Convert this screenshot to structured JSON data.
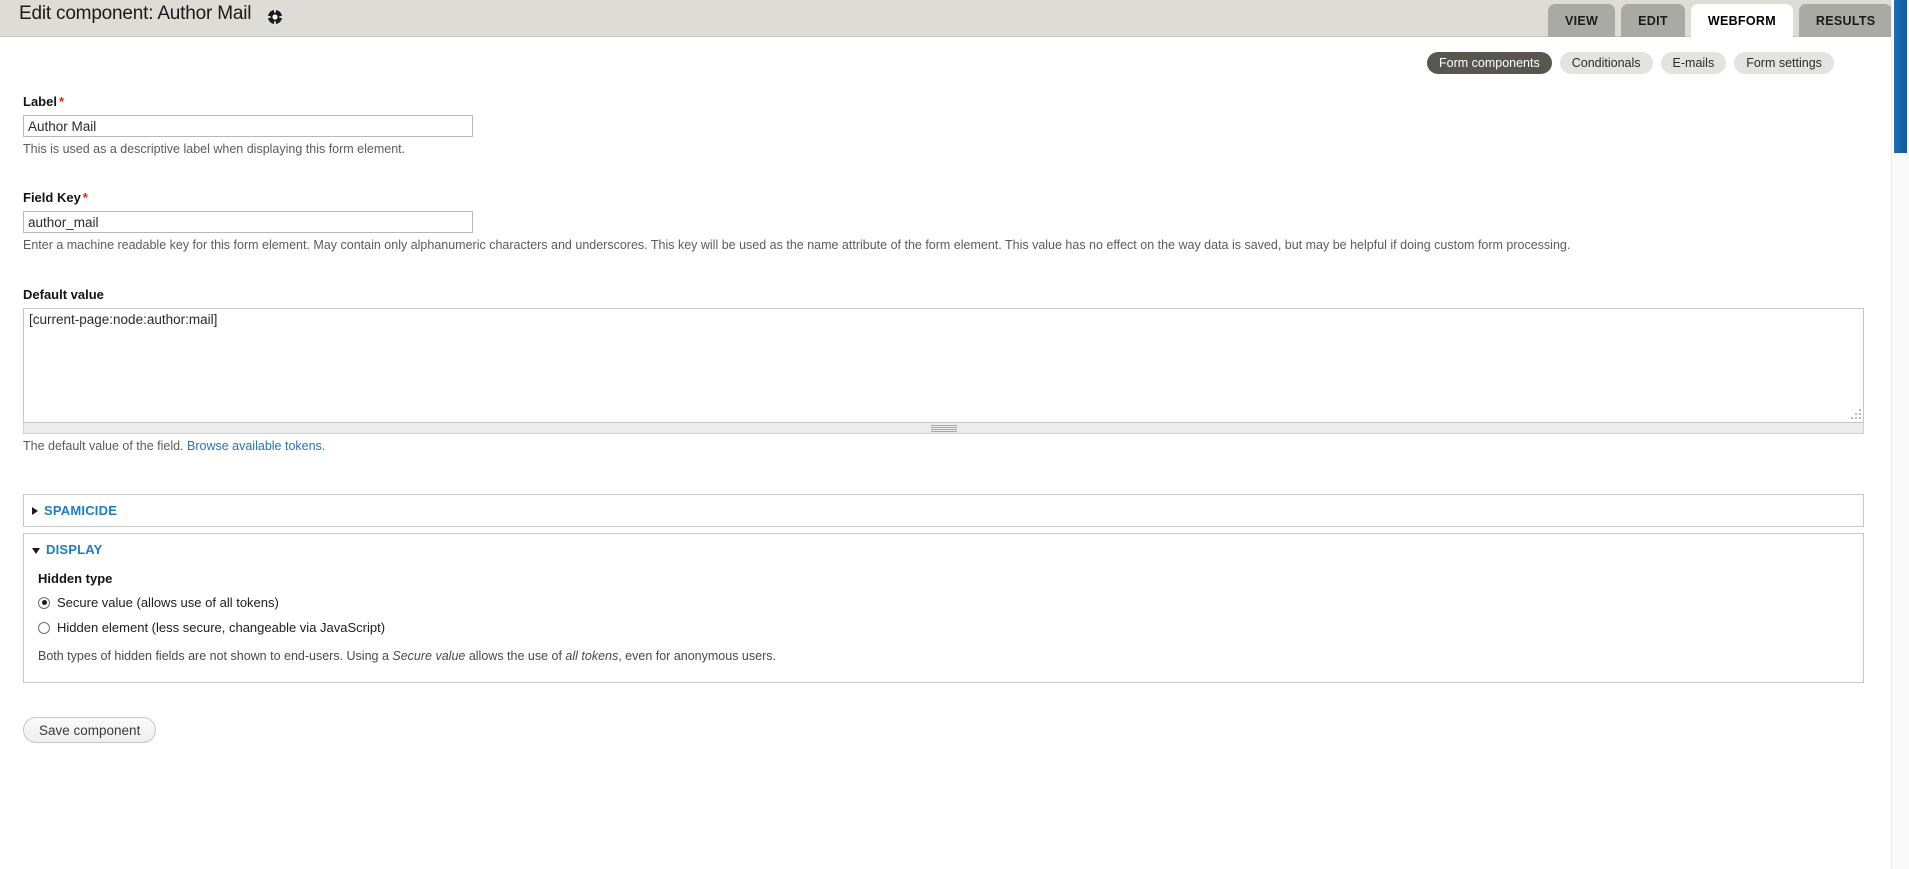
{
  "header": {
    "title": "Edit component: Author Mail",
    "gear_icon": "gear-icon"
  },
  "primary_tabs": [
    {
      "label": "VIEW",
      "active": false
    },
    {
      "label": "EDIT",
      "active": false
    },
    {
      "label": "WEBFORM",
      "active": true
    },
    {
      "label": "RESULTS",
      "active": false
    }
  ],
  "secondary_tabs": [
    {
      "label": "Form components",
      "active": true
    },
    {
      "label": "Conditionals",
      "active": false
    },
    {
      "label": "E-mails",
      "active": false
    },
    {
      "label": "Form settings",
      "active": false
    }
  ],
  "fields": {
    "label": {
      "title": "Label",
      "required_marker": "*",
      "value": "Author Mail",
      "description": "This is used as a descriptive label when displaying this form element."
    },
    "field_key": {
      "title": "Field Key",
      "required_marker": "*",
      "value": "author_mail",
      "description": "Enter a machine readable key for this form element. May contain only alphanumeric characters and underscores. This key will be used as the name attribute of the form element. This value has no effect on the way data is saved, but may be helpful if doing custom form processing."
    },
    "default_value": {
      "title": "Default value",
      "value": "[current-page:node:author:mail]",
      "description_prefix": "The default value of the field. ",
      "description_link": "Browse available tokens",
      "description_suffix": "."
    }
  },
  "fieldsets": {
    "spamicide": {
      "legend": "SPAMICIDE",
      "state": "collapsed"
    },
    "display": {
      "legend": "DISPLAY",
      "state": "expanded",
      "hidden_type_label": "Hidden type",
      "options": [
        {
          "label": "Secure value (allows use of all tokens)",
          "checked": true
        },
        {
          "label": "Hidden element (less secure, changeable via JavaScript)",
          "checked": false
        }
      ],
      "note_part1": "Both types of hidden fields are not shown to end-users. Using a ",
      "note_em1": "Secure value",
      "note_part2": " allows the use of ",
      "note_em2": "all tokens",
      "note_part3": ", even for anonymous users."
    }
  },
  "actions": {
    "save_label": "Save component"
  },
  "colors": {
    "admin_bar": "#dddcd6",
    "tab_inactive": "#a9a9a5",
    "pill_active": "#595650",
    "legend_blue": "#1f7dc0",
    "link_blue": "#2b71b8",
    "required_red": "#e32700",
    "scrollbar_blue": "#0e5a9c"
  }
}
